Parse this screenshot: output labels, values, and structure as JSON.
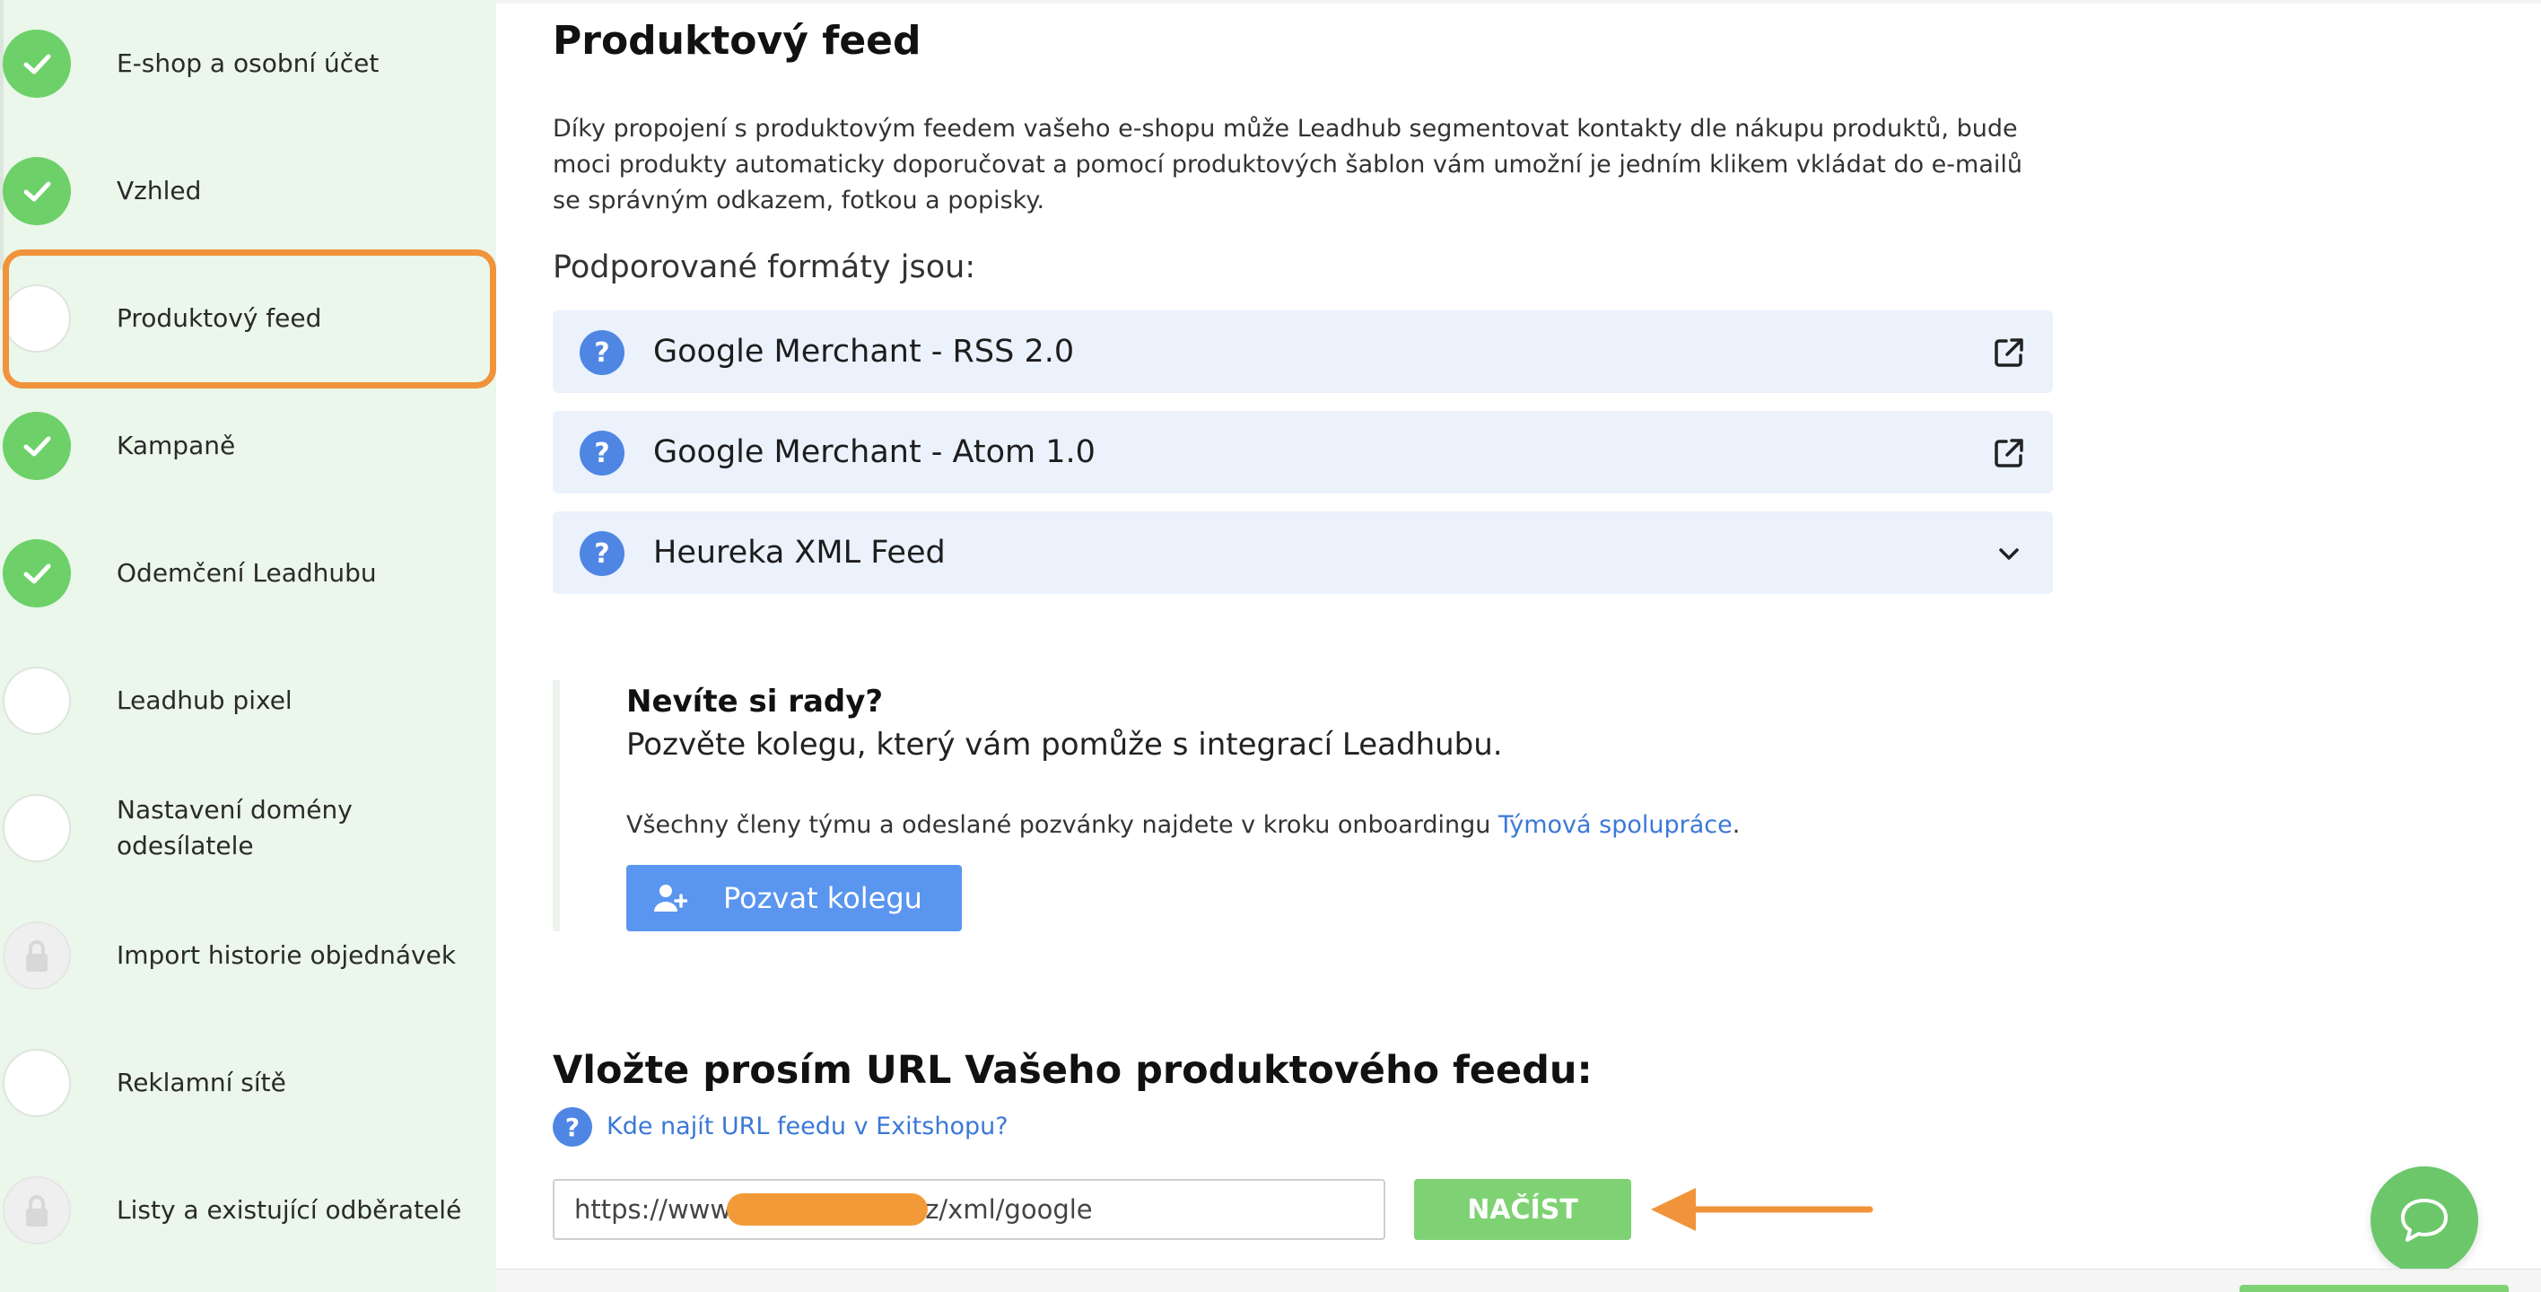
{
  "sidebar": {
    "items": [
      {
        "label": "E-shop a osobní účet",
        "status": "done"
      },
      {
        "label": "Vzhled",
        "status": "done"
      },
      {
        "label": "Produktový feed",
        "status": "current"
      },
      {
        "label": "Kampaně",
        "status": "done"
      },
      {
        "label": "Odemčení Leadhubu",
        "status": "done"
      },
      {
        "label": "Leadhub pixel",
        "status": "todo"
      },
      {
        "label": "Nastavení domény odesílatele",
        "status": "todo"
      },
      {
        "label": "Import historie objednávek",
        "status": "locked"
      },
      {
        "label": "Reklamní sítě",
        "status": "todo"
      },
      {
        "label": "Listy a existující odběratelé",
        "status": "locked"
      }
    ]
  },
  "main": {
    "title": "Produktový feed",
    "intro": "Díky propojení s produktovým feedem vašeho e-shopu může Leadhub segmentovat kontakty dle nákupu produktů, bude moci produkty automaticky doporučovat a pomocí produktových šablon vám umožní je jedním klikem vkládat do e-mailů se správným odkazem, fotkou a popisky.",
    "formats_title": "Podporované formáty jsou:",
    "formats": [
      {
        "label": "Google Merchant - RSS 2.0",
        "action_icon": "external-link-icon"
      },
      {
        "label": "Google Merchant - Atom 1.0",
        "action_icon": "external-link-icon"
      },
      {
        "label": "Heureka XML Feed",
        "action_icon": "chevron-down-icon"
      }
    ],
    "help": {
      "title": "Nevíte si rady?",
      "subtitle": "Pozvěte kolegu, který vám pomůže s integrací Leadhubu.",
      "text": "Všechny členy týmu a odeslané pozvánky najdete v kroku onboardingu ",
      "link": "Týmová spolupráce",
      "text_end": ".",
      "button": "Pozvat kolegu"
    },
    "url": {
      "title": "Vložte prosím URL Vašeho produktového feedu:",
      "help_link": "Kde najít URL feedu v Exitshopu?",
      "value": "https://www.                    .cz/xml/google",
      "load_button": "NAČÍST"
    }
  },
  "colors": {
    "sidebar_bg": "#eaf7ea",
    "done_green": "#6dd069",
    "active_outline": "#f0933a",
    "format_bg": "#ebf2fc",
    "accent_blue": "#4f86e3",
    "link_blue": "#3b78d8",
    "button_blue": "#5a95ef",
    "load_green": "#7fd274",
    "chat_green": "#6cc76a"
  }
}
